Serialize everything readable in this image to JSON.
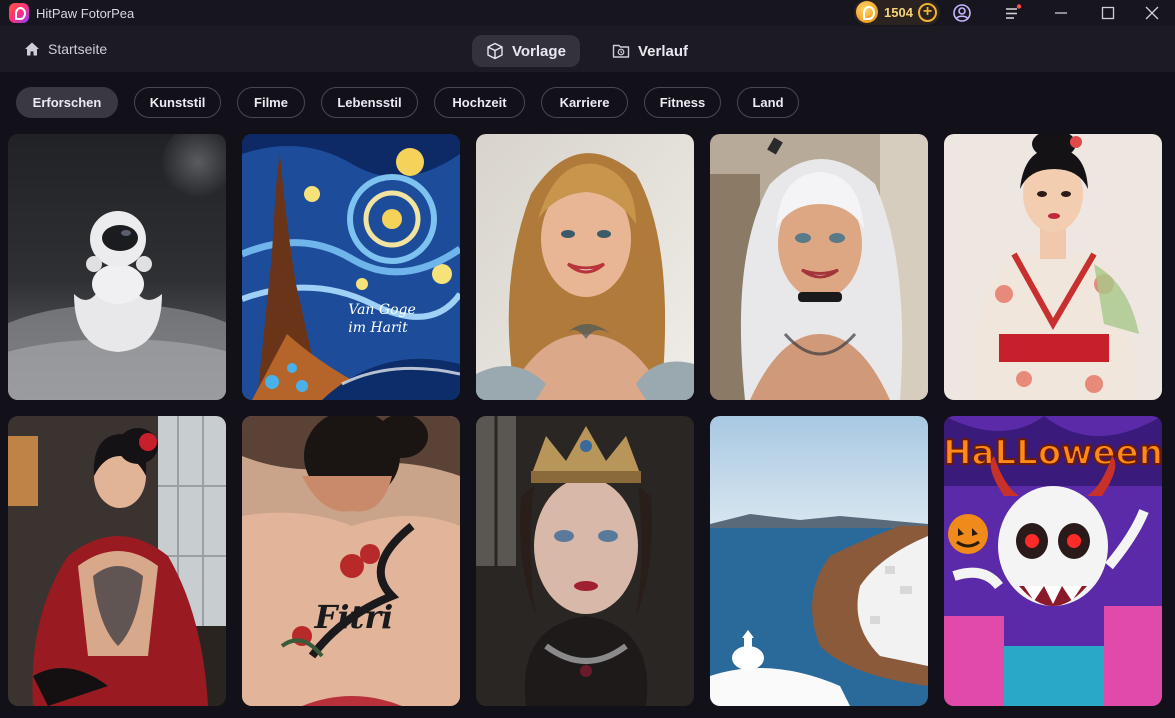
{
  "app": {
    "title": "HitPaw FotorPea"
  },
  "credits": {
    "count": "1504"
  },
  "nav": {
    "home_label": "Startseite",
    "tabs": [
      {
        "label": "Vorlage",
        "active": true
      },
      {
        "label": "Verlauf",
        "active": false
      }
    ]
  },
  "categories": [
    "Erforschen",
    "Kunststil",
    "Filme",
    "Lebensstil",
    "Hochzeit",
    "Karriere",
    "Fitness",
    "Land"
  ],
  "selected_category": "Erforschen",
  "templates": [
    {
      "name": "astronaut-egg",
      "caption": ""
    },
    {
      "name": "starry-night",
      "caption_line1": "Van Goge",
      "caption_line2": "im Harit"
    },
    {
      "name": "blonde-woman-tattoo",
      "caption": ""
    },
    {
      "name": "white-hair-woman-tattoo",
      "caption": ""
    },
    {
      "name": "kimono-woman",
      "caption": ""
    },
    {
      "name": "kimono-back-tattoo",
      "caption": ""
    },
    {
      "name": "back-tattoo-script",
      "caption": "Fitri"
    },
    {
      "name": "queen-crown",
      "caption": ""
    },
    {
      "name": "santorini-coast",
      "caption": ""
    },
    {
      "name": "halloween-skull",
      "caption": "HaLLoween"
    }
  ],
  "colors": {
    "background": "#121018",
    "accent": "#f3b233",
    "chip_border": "#4a4852"
  }
}
